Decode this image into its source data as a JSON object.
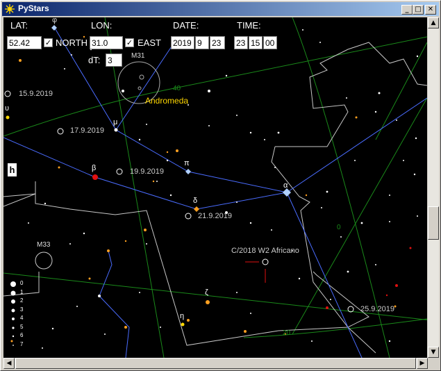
{
  "window": {
    "title": "PyStars"
  },
  "controls": {
    "lat_label": "LAT:",
    "lat_value": "52.42",
    "north_checked": "✓",
    "north_label": "NORTH",
    "lon_label": "LON:",
    "lon_value": "31.0",
    "east_checked": "✓",
    "east_label": "EAST",
    "date_label": "DATE:",
    "date_year": "2019",
    "date_month": "9",
    "date_day": "23",
    "time_label": "TIME:",
    "time_hour": "23",
    "time_min": "15",
    "time_sec": "00",
    "dt_label": "dT:",
    "dt_value": "3",
    "h_button": "h"
  },
  "sky": {
    "greek": {
      "phi": "φ",
      "mu": "μ",
      "beta": "β",
      "pi": "π",
      "alpha": "α",
      "delta": "δ",
      "zeta": "ζ",
      "eta": "η",
      "upsilon": "υ"
    },
    "deep_sky": {
      "m31": "M31",
      "m33": "M33",
      "andromeda": "Andromeda"
    },
    "comet": "C/2018 W2 Africano",
    "track_dates": [
      "15.9.2019",
      "17.9.2019",
      "19.9.2019",
      "21.9.2019",
      "25.9.2019"
    ],
    "grid_labels": {
      "g40": "40",
      "g0": "0",
      "g20": "20"
    },
    "magnitude_legend": [
      "0",
      "1",
      "2",
      "3",
      "4",
      "5",
      "6",
      "7"
    ]
  },
  "colors": {
    "constellation_line": "#4a6cff",
    "boundary_line": "#c8c8c8",
    "grid_line": "#1a8a1a",
    "andromeda_label": "#ffd700",
    "comet_tail": "#e01010"
  }
}
